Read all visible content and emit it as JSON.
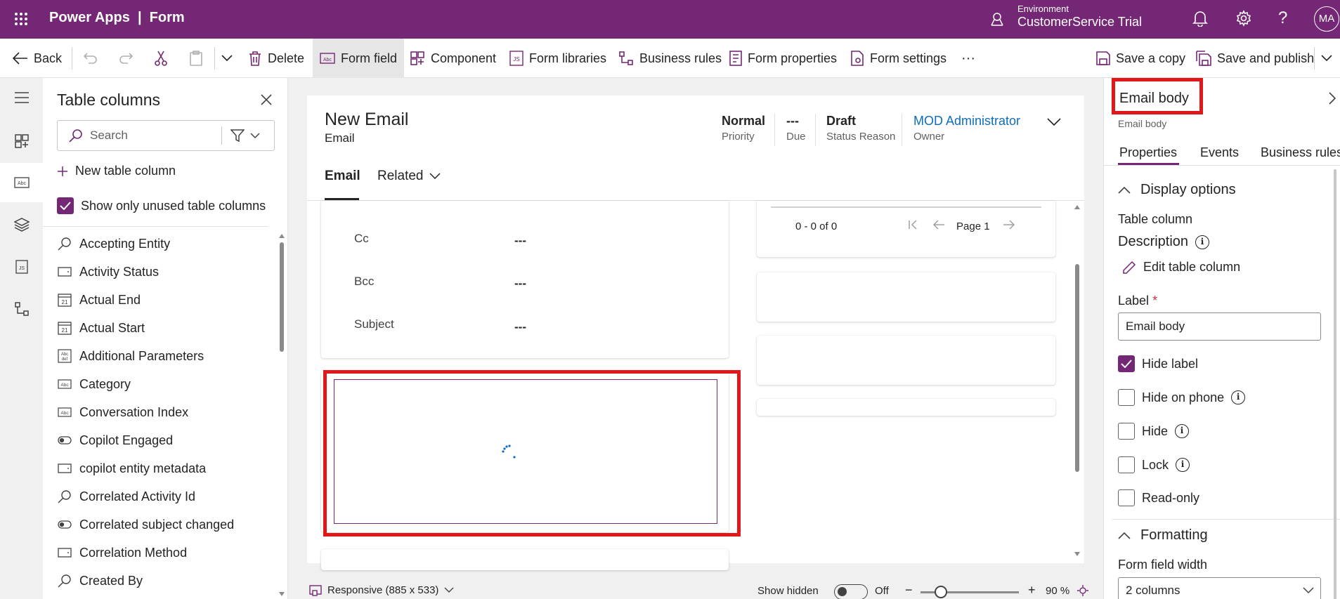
{
  "topbar": {
    "title": "Power Apps  |  Form",
    "environment_label": "Environment",
    "environment_name": "CustomerService Trial",
    "avatar": "MA",
    "bg_color": "#742774"
  },
  "commandbar": {
    "back": "Back",
    "delete": "Delete",
    "form_field": "Form field",
    "component": "Component",
    "form_libraries": "Form libraries",
    "business_rules": "Business rules",
    "form_properties": "Form properties",
    "form_settings": "Form settings",
    "more": "···",
    "save_copy": "Save a copy",
    "save_publish": "Save and publish"
  },
  "column_panel": {
    "title": "Table columns",
    "search_placeholder": "Search",
    "new_column": "New table column",
    "show_unused": "Show only unused table columns",
    "show_unused_checked": true,
    "items": [
      {
        "label": "Accepting Entity",
        "icon": "lookup-icon"
      },
      {
        "label": "Activity Status",
        "icon": "option-set-icon"
      },
      {
        "label": "Actual End",
        "icon": "calendar-icon"
      },
      {
        "label": "Actual Start",
        "icon": "calendar-icon"
      },
      {
        "label": "Additional Parameters",
        "icon": "multiline-text-icon"
      },
      {
        "label": "Category",
        "icon": "text-icon"
      },
      {
        "label": "Conversation Index",
        "icon": "text-icon"
      },
      {
        "label": "Copilot Engaged",
        "icon": "toggle-icon"
      },
      {
        "label": "copilot entity metadata",
        "icon": "option-set-icon"
      },
      {
        "label": "Correlated Activity Id",
        "icon": "lookup-icon"
      },
      {
        "label": "Correlated subject changed",
        "icon": "toggle-icon"
      },
      {
        "label": "Correlation Method",
        "icon": "option-set-icon"
      },
      {
        "label": "Created By",
        "icon": "lookup-icon"
      }
    ]
  },
  "form": {
    "record_title": "New Email",
    "record_type": "Email",
    "header_fields": [
      {
        "value": "Normal",
        "label": "Priority"
      },
      {
        "value": "---",
        "label": "Due"
      },
      {
        "value": "Draft",
        "label": "Status Reason"
      },
      {
        "value": "MOD Administrator",
        "label": "Owner"
      }
    ],
    "tabs": [
      "Email",
      "Related"
    ],
    "fields": [
      {
        "label": "Cc",
        "value": "---"
      },
      {
        "label": "Bcc",
        "value": "---"
      },
      {
        "label": "Subject",
        "value": "---"
      }
    ],
    "grid": {
      "count": "0 - 0 of 0",
      "page": "Page 1"
    }
  },
  "properties": {
    "title": "Email body",
    "subtitle": "Email body",
    "tabs": [
      "Properties",
      "Events",
      "Business rules"
    ],
    "display_options": "Display options",
    "table_column_label": "Table column",
    "table_column_value": "Description",
    "edit_column": "Edit table column",
    "label_caption": "Label",
    "required_mark": "*",
    "label_value": "Email body",
    "hide_label": "Hide label",
    "hide_label_checked": true,
    "hide_on_phone": "Hide on phone",
    "hide": "Hide",
    "lock": "Lock",
    "read_only": "Read-only",
    "formatting": "Formatting",
    "width_caption": "Form field width",
    "width_value": "2 columns"
  },
  "statusbar": {
    "responsive": "Responsive (885 x 533)",
    "show_hidden": "Show hidden",
    "toggle_state": "Off",
    "zoom": "90 %"
  },
  "colors": {
    "accent": "#742774",
    "link": "#0f6cbd",
    "highlight": "#e0181a"
  }
}
